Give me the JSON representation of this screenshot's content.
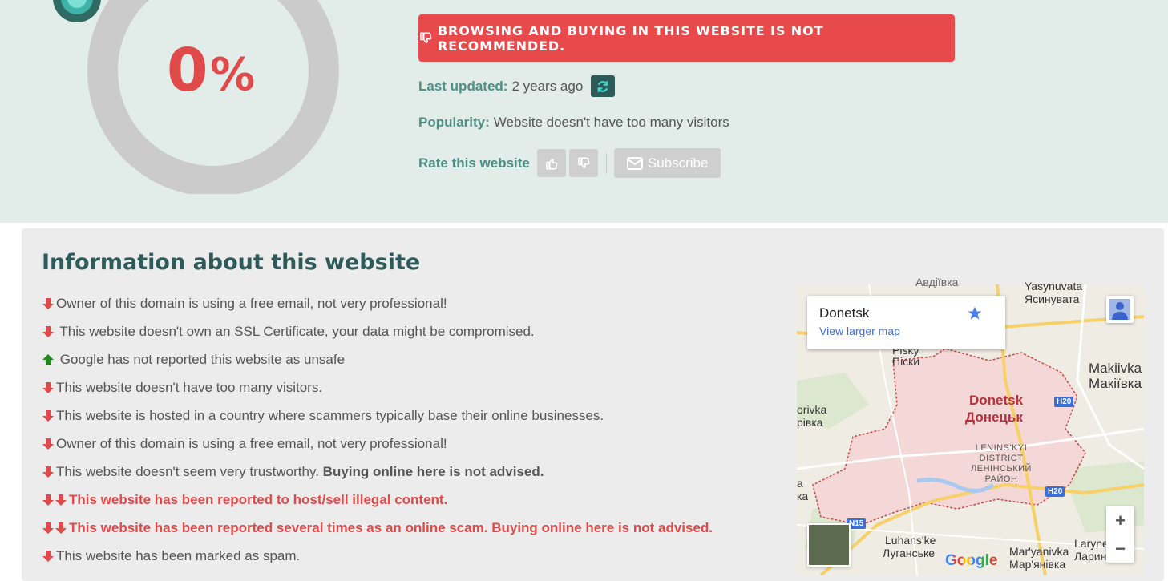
{
  "score": {
    "value": "0",
    "unit": "%"
  },
  "alert": {
    "text": "BROWSING AND BUYING IN THIS WEBSITE IS NOT RECOMMENDED."
  },
  "last_updated": {
    "label": "Last updated:",
    "value": "2 years ago"
  },
  "popularity": {
    "label": "Popularity:",
    "value": "Website doesn't have too many visitors"
  },
  "rate": {
    "label": "Rate this website",
    "subscribe_label": "Subscribe"
  },
  "info": {
    "title": "Information about this website",
    "items": [
      {
        "text": "Owner of this domain is using a free email, not very professional!",
        "arrow": "down"
      },
      {
        "text": " This website doesn't own an SSL Certificate, your data might be compromised.",
        "arrow": "down"
      },
      {
        "text": " Google has not reported this website as unsafe",
        "arrow": "up"
      },
      {
        "text": "This website doesn't have too many visitors.",
        "arrow": "down"
      },
      {
        "text": "This website is hosted in a country where scammers typically base their online businesses.",
        "arrow": "down"
      },
      {
        "text": "Owner of this domain is using a free email, not very professional!",
        "arrow": "down"
      },
      {
        "text": "This website doesn't seem very trustworthy. ",
        "bold": "Buying online here is not advised.",
        "arrow": "down"
      },
      {
        "text": "This website has been reported to host/sell illegal content.",
        "arrow": "double-down"
      },
      {
        "text": "This website has been reported several times as an online scam. Buying online here is not advised.",
        "arrow": "double-down"
      },
      {
        "text": "This website has been marked as spam.",
        "arrow": "down"
      }
    ]
  },
  "map": {
    "card_title": "Donetsk",
    "card_link": "View larger map",
    "city_en": "Donetsk",
    "city_uk": "Донецьк",
    "labels": {
      "yasynuvata_en": "Yasynuvata",
      "yasynuvata_uk": "Ясинувата",
      "makiivka_en": "Makiivka",
      "makiivka_uk": "Макіївка",
      "pisky_en": "Pisky",
      "pisky_uk": "Піски",
      "orivka_en": "orivka",
      "orivka_uk": "рівка",
      "district_1": "LENINS'KYI",
      "district_2": "DISTRICT",
      "district_3": "ЛЕНІНСЬКИЙ",
      "district_4": "РАЙОН",
      "luhanske_en": "Luhans'ke",
      "luhanske_uk": "Луганське",
      "maryanivka_en": "Mar'yanivka",
      "maryanivka_uk": "Мар'янівка",
      "laryne_en": "Laryne",
      "laryne_uk": "Ларин",
      "edge_a": "a",
      "edge_ka": "ка",
      "top_cut": "Авдіївка"
    },
    "shields": {
      "h20_a": "H20",
      "h20_b": "H20",
      "n15": "N15"
    },
    "zoom_in": "+",
    "zoom_out": "−",
    "logo": "Google"
  },
  "colors": {
    "danger": "#e8494b",
    "accent": "#4e8f86",
    "dark_teal": "#2f5a5a",
    "up": "#1e8a1e"
  }
}
